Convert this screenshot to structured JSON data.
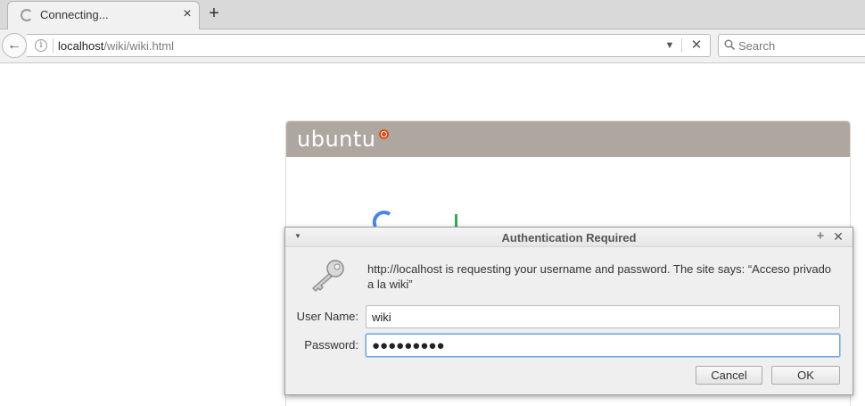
{
  "tab": {
    "title": "Connecting...",
    "close_glyph": "×",
    "new_tab_glyph": "+"
  },
  "navbar": {
    "back_glyph": "←",
    "url_host": "localhost",
    "url_path": "/wiki/wiki.html",
    "info_glyph": "i",
    "dropdown_glyph": "▼",
    "stop_glyph": "✕",
    "search_placeholder": "Search"
  },
  "page": {
    "logo_text": "ubuntu"
  },
  "dialog": {
    "title": "Authentication Required",
    "menu_glyph": "▼",
    "max_glyph": "+",
    "close_glyph": "✕",
    "message": "http://localhost is requesting your username and password. The site says: “Acceso privado a la wiki”",
    "username_label": "User Name:",
    "username_value": "wiki",
    "password_label": "Password:",
    "password_value": "●●●●●●●●●",
    "cancel_label": "Cancel",
    "ok_label": "OK"
  },
  "colors": {
    "ubuntu_header": "#aea79f",
    "ubuntu_orange": "#dd4814",
    "focus_border": "#6fa8dc"
  }
}
